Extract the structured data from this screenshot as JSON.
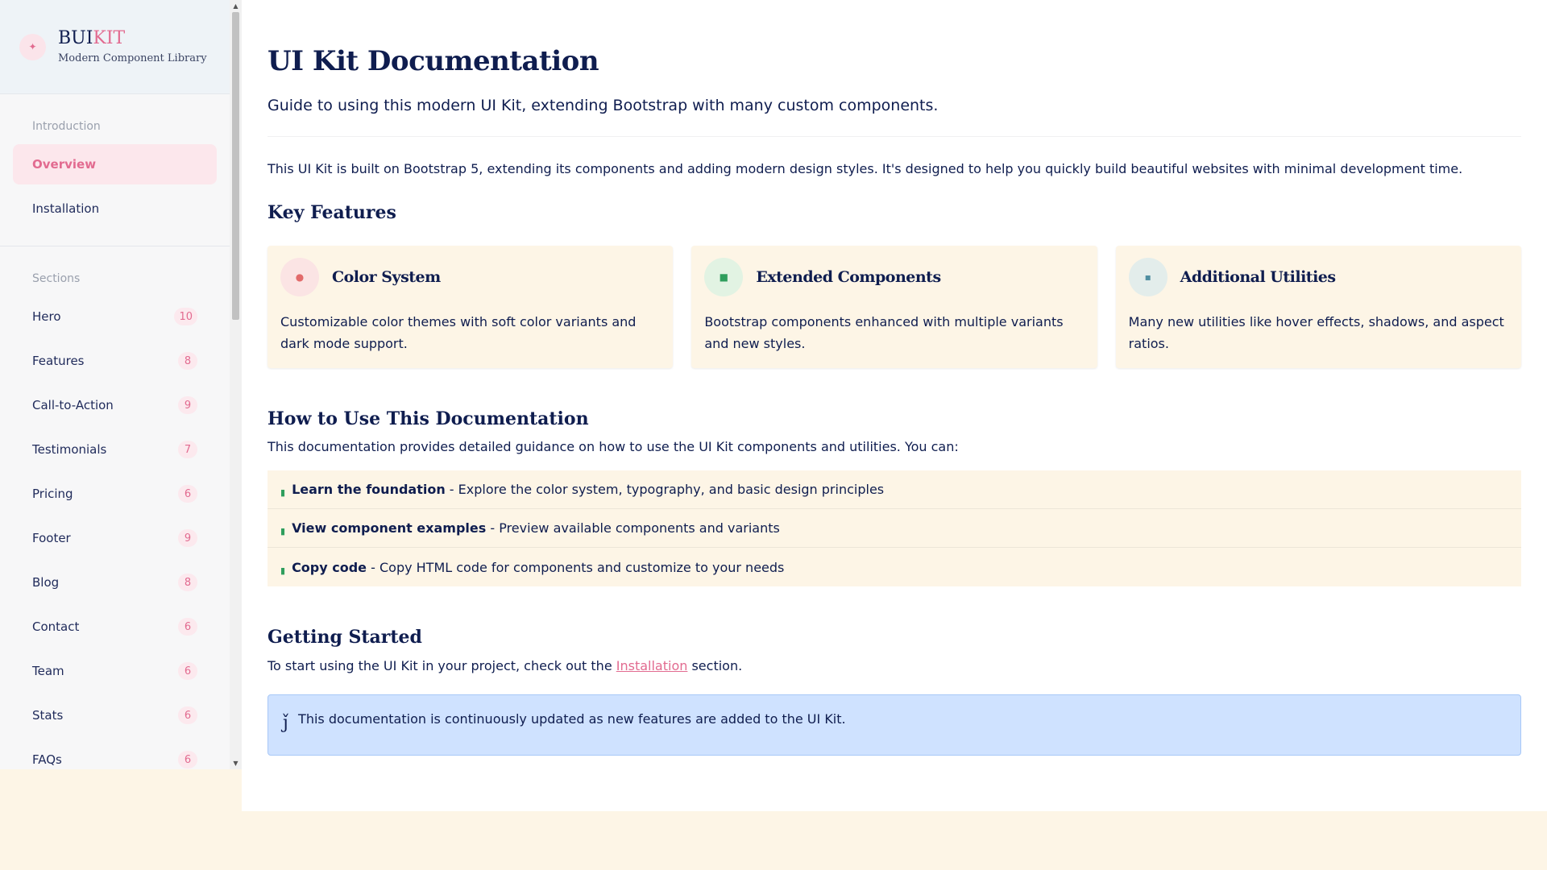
{
  "brand": {
    "icon": "sparkle-icon",
    "title_main": "BUI",
    "title_accent": "KIT",
    "subtitle": "Modern Component Library"
  },
  "nav": {
    "introduction_heading": "Introduction",
    "introduction_items": [
      {
        "label": "Overview",
        "active": true
      },
      {
        "label": "Installation",
        "active": false
      }
    ],
    "sections_heading": "Sections",
    "section_items": [
      {
        "label": "Hero",
        "count": "10"
      },
      {
        "label": "Features",
        "count": "8"
      },
      {
        "label": "Call-to-Action",
        "count": "9"
      },
      {
        "label": "Testimonials",
        "count": "7"
      },
      {
        "label": "Pricing",
        "count": "6"
      },
      {
        "label": "Footer",
        "count": "9"
      },
      {
        "label": "Blog",
        "count": "8"
      },
      {
        "label": "Contact",
        "count": "6"
      },
      {
        "label": "Team",
        "count": "6"
      },
      {
        "label": "Stats",
        "count": "6"
      },
      {
        "label": "FAQs",
        "count": "6"
      }
    ]
  },
  "main": {
    "title": "UI Kit Documentation",
    "subtitle": "Guide to using this modern UI Kit, extending Bootstrap with many custom components.",
    "intro": "This UI Kit is built on Bootstrap 5, extending its components and adding modern design styles. It's designed to help you quickly build beautiful websites with minimal development time.",
    "key_features_title": "Key Features",
    "features": [
      {
        "title": "Color System",
        "description": "Customizable color themes with soft color variants and dark mode support.",
        "icon": "palette-icon",
        "icon_bg": "#fbe4e4",
        "icon_color": "#e26b6b"
      },
      {
        "title": "Extended Components",
        "description": "Bootstrap components enhanced with multiple variants and new styles.",
        "icon": "puzzle-icon",
        "icon_bg": "#e2f3e3",
        "icon_color": "#2f9e5d"
      },
      {
        "title": "Additional Utilities",
        "description": "Many new utilities like hover effects, shadows, and aspect ratios.",
        "icon": "tools-icon",
        "icon_bg": "#e3edeb",
        "icon_color": "#4f8ea0"
      }
    ],
    "howto_title": "How to Use This Documentation",
    "howto_text": "This documentation provides detailed guidance on how to use the UI Kit components and utilities. You can:",
    "steps": [
      {
        "strong": "Learn the foundation",
        "text": " - Explore the color system, typography, and basic design principles"
      },
      {
        "strong": "View component examples",
        "text": " - Preview available components and variants"
      },
      {
        "strong": "Copy code",
        "text": " - Copy HTML code for components and customize to your needs"
      }
    ],
    "getting_started_title": "Getting Started",
    "getting_started_before": "To start using the UI Kit in your project, check out the ",
    "getting_started_link": "Installation",
    "getting_started_after": " section.",
    "alert_text": "This documentation is continuously updated as new features are added to the UI Kit."
  },
  "colors": {
    "accent": "#e26b90",
    "text": "#0f1d4f",
    "cream": "#fdf5e6",
    "alert_bg": "#cfe2ff"
  }
}
